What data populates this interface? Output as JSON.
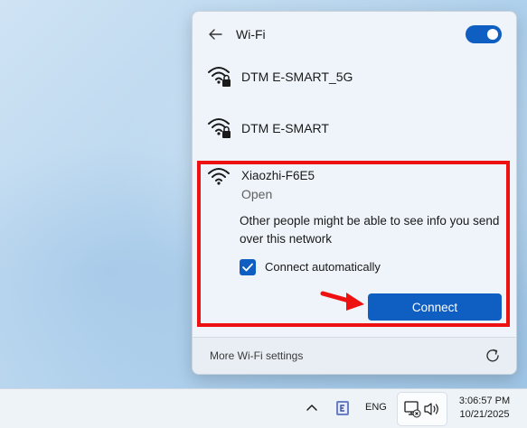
{
  "flyout": {
    "title": "Wi-Fi",
    "wifi_enabled": true,
    "networks": [
      {
        "name": "DTM E-SMART_5G",
        "secured": true,
        "icon": "wifi-secured-icon"
      },
      {
        "name": "DTM E-SMART",
        "secured": true,
        "icon": "wifi-secured-icon"
      }
    ],
    "expanded": {
      "name": "Xiaozhi-F6E5",
      "status": "Open",
      "icon": "wifi-icon",
      "warning": "Other people might be able to see info you send over this network",
      "auto_connect_label": "Connect automatically",
      "auto_connect_checked": true,
      "connect_label": "Connect"
    },
    "footer": {
      "more_settings": "More Wi-Fi settings"
    }
  },
  "taskbar": {
    "language": "ENG",
    "time": "3:06:57 PM",
    "date": "10/21/2025"
  },
  "colors": {
    "accent": "#0f5fc2",
    "highlight": "#ee1111"
  }
}
